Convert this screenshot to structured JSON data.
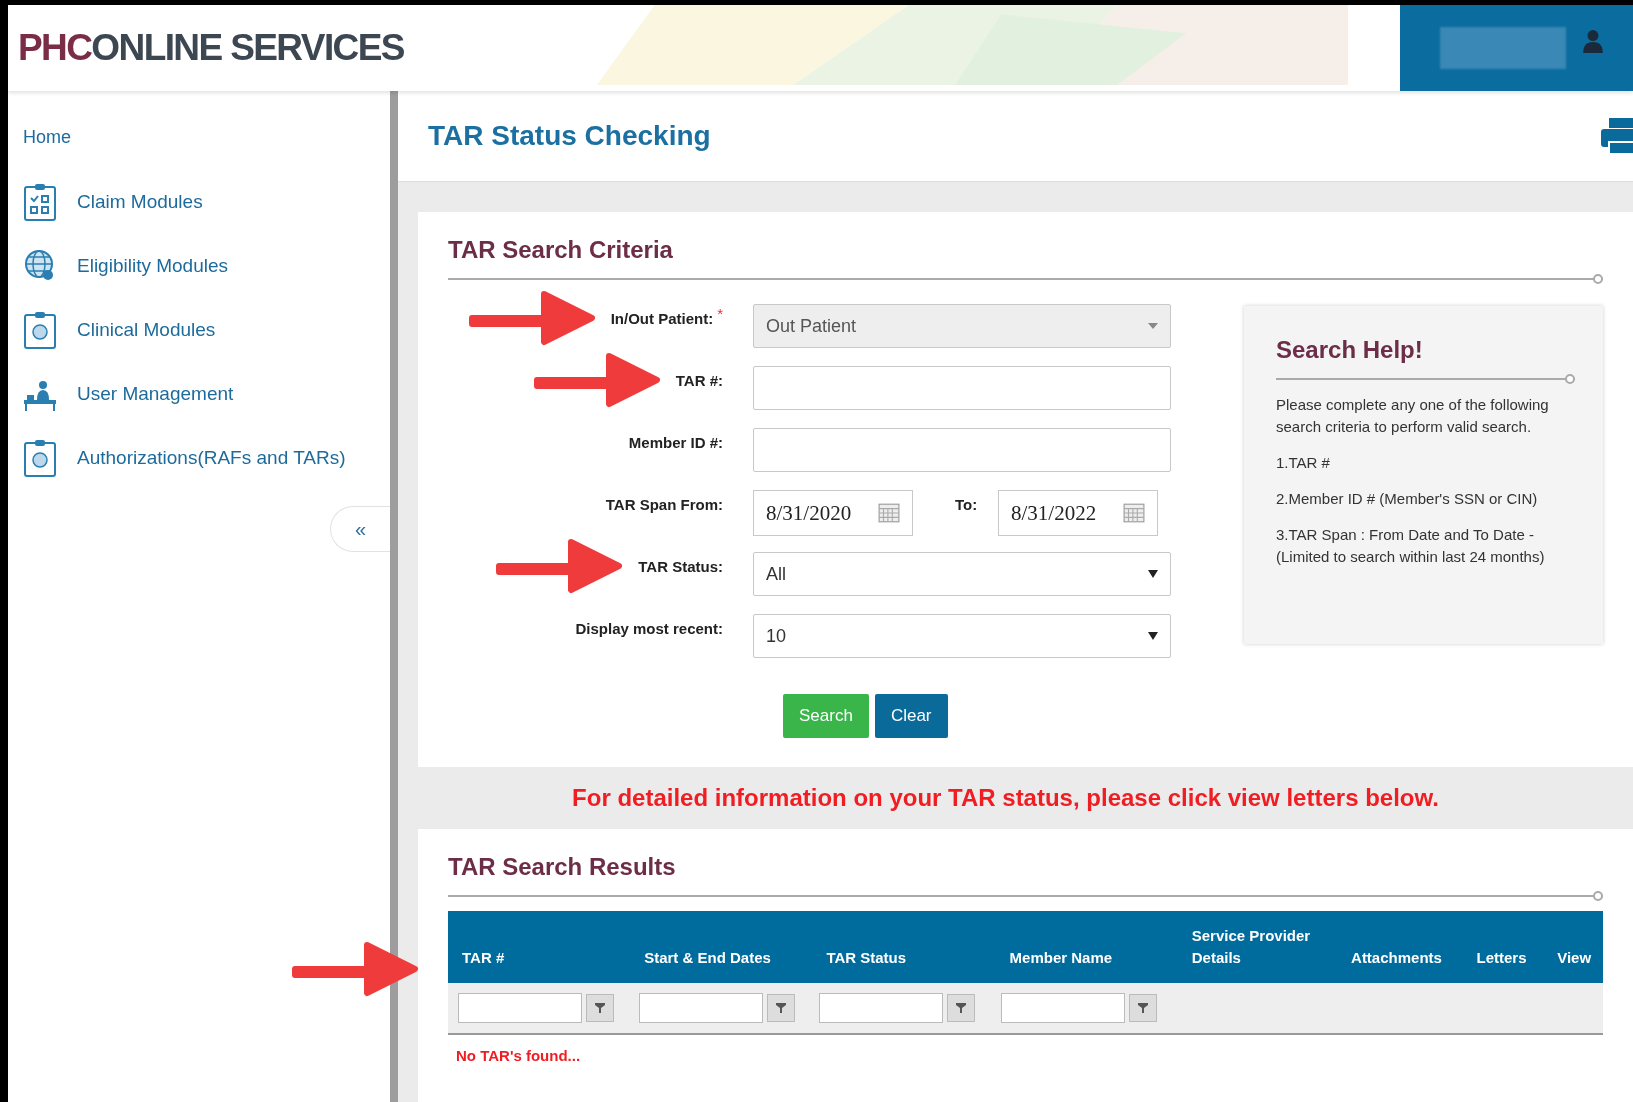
{
  "header": {
    "logo": {
      "prefix": "PHC",
      "name": "ONLINE SERVICES"
    }
  },
  "sidebar": {
    "home": "Home",
    "items": [
      {
        "label": "Claim Modules",
        "kind": "checklist"
      },
      {
        "label": "Eligibility Modules",
        "kind": "globe"
      },
      {
        "label": "Clinical Modules",
        "kind": "brain"
      },
      {
        "label": "User Management",
        "kind": "desk"
      },
      {
        "label": "Authorizations(RAFs and TARs)",
        "kind": "brain"
      }
    ],
    "collapse": "«"
  },
  "page": {
    "title": "TAR Status Checking"
  },
  "criteria": {
    "title": "TAR Search Criteria",
    "rows": [
      {
        "kind": "select",
        "label": "In/Out Patient:",
        "required_mark": "*",
        "annotated": true,
        "disabled": true,
        "value": "Out Patient"
      },
      {
        "kind": "text",
        "label": "TAR #:",
        "annotated": true
      },
      {
        "kind": "text",
        "label": "Member ID #:",
        "annotated": false
      },
      {
        "kind": "daterange",
        "label": "TAR Span From:",
        "annotated": false,
        "from": "8/31/2020",
        "to_label": "To:",
        "to": "8/31/2022"
      },
      {
        "kind": "select",
        "label": "TAR Status:",
        "annotated": true,
        "disabled": false,
        "value": "All"
      },
      {
        "kind": "select",
        "label": "Display most recent:",
        "annotated": false,
        "disabled": false,
        "value": "10"
      }
    ],
    "buttons": [
      {
        "label": "Search",
        "kind": "success"
      },
      {
        "label": "Clear",
        "kind": "primary"
      }
    ]
  },
  "help": {
    "title": "Search Help!",
    "intro": "Please complete any one of the following search criteria to perform valid search.",
    "items": [
      "1.TAR #",
      "2.Member ID # (Member's SSN or CIN)",
      "3.TAR Span : From Date and To Date - (Limited to search within last 24 months)"
    ]
  },
  "notice": "For detailed information on your TAR status, please click view letters below.",
  "results": {
    "title": "TAR Search Results",
    "annotated": true,
    "columns": [
      {
        "label": "TAR #",
        "filter": true
      },
      {
        "label": "Start & End Dates",
        "filter": true
      },
      {
        "label": "TAR Status",
        "filter": true
      },
      {
        "label": "Member Name",
        "filter": true
      },
      {
        "label": "Service Provider Details",
        "filter": false
      },
      {
        "label": "Attachments",
        "filter": false
      },
      {
        "label": "Letters",
        "filter": false
      },
      {
        "label": "View",
        "filter": false
      }
    ],
    "empty": "No TAR's found..."
  }
}
